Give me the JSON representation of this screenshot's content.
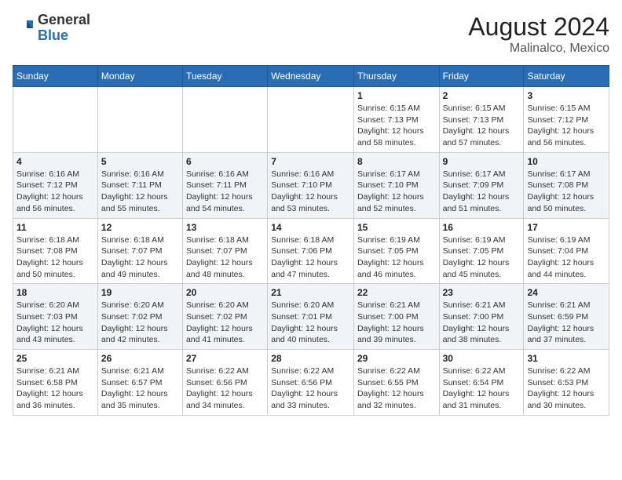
{
  "header": {
    "logo_general": "General",
    "logo_blue": "Blue",
    "month_year": "August 2024",
    "location": "Malinalco, Mexico"
  },
  "calendar": {
    "days_of_week": [
      "Sunday",
      "Monday",
      "Tuesday",
      "Wednesday",
      "Thursday",
      "Friday",
      "Saturday"
    ],
    "weeks": [
      [
        {
          "day": "",
          "info": ""
        },
        {
          "day": "",
          "info": ""
        },
        {
          "day": "",
          "info": ""
        },
        {
          "day": "",
          "info": ""
        },
        {
          "day": "1",
          "info": "Sunrise: 6:15 AM\nSunset: 7:13 PM\nDaylight: 12 hours\nand 58 minutes."
        },
        {
          "day": "2",
          "info": "Sunrise: 6:15 AM\nSunset: 7:13 PM\nDaylight: 12 hours\nand 57 minutes."
        },
        {
          "day": "3",
          "info": "Sunrise: 6:15 AM\nSunset: 7:12 PM\nDaylight: 12 hours\nand 56 minutes."
        }
      ],
      [
        {
          "day": "4",
          "info": "Sunrise: 6:16 AM\nSunset: 7:12 PM\nDaylight: 12 hours\nand 56 minutes."
        },
        {
          "day": "5",
          "info": "Sunrise: 6:16 AM\nSunset: 7:11 PM\nDaylight: 12 hours\nand 55 minutes."
        },
        {
          "day": "6",
          "info": "Sunrise: 6:16 AM\nSunset: 7:11 PM\nDaylight: 12 hours\nand 54 minutes."
        },
        {
          "day": "7",
          "info": "Sunrise: 6:16 AM\nSunset: 7:10 PM\nDaylight: 12 hours\nand 53 minutes."
        },
        {
          "day": "8",
          "info": "Sunrise: 6:17 AM\nSunset: 7:10 PM\nDaylight: 12 hours\nand 52 minutes."
        },
        {
          "day": "9",
          "info": "Sunrise: 6:17 AM\nSunset: 7:09 PM\nDaylight: 12 hours\nand 51 minutes."
        },
        {
          "day": "10",
          "info": "Sunrise: 6:17 AM\nSunset: 7:08 PM\nDaylight: 12 hours\nand 50 minutes."
        }
      ],
      [
        {
          "day": "11",
          "info": "Sunrise: 6:18 AM\nSunset: 7:08 PM\nDaylight: 12 hours\nand 50 minutes."
        },
        {
          "day": "12",
          "info": "Sunrise: 6:18 AM\nSunset: 7:07 PM\nDaylight: 12 hours\nand 49 minutes."
        },
        {
          "day": "13",
          "info": "Sunrise: 6:18 AM\nSunset: 7:07 PM\nDaylight: 12 hours\nand 48 minutes."
        },
        {
          "day": "14",
          "info": "Sunrise: 6:18 AM\nSunset: 7:06 PM\nDaylight: 12 hours\nand 47 minutes."
        },
        {
          "day": "15",
          "info": "Sunrise: 6:19 AM\nSunset: 7:05 PM\nDaylight: 12 hours\nand 46 minutes."
        },
        {
          "day": "16",
          "info": "Sunrise: 6:19 AM\nSunset: 7:05 PM\nDaylight: 12 hours\nand 45 minutes."
        },
        {
          "day": "17",
          "info": "Sunrise: 6:19 AM\nSunset: 7:04 PM\nDaylight: 12 hours\nand 44 minutes."
        }
      ],
      [
        {
          "day": "18",
          "info": "Sunrise: 6:20 AM\nSunset: 7:03 PM\nDaylight: 12 hours\nand 43 minutes."
        },
        {
          "day": "19",
          "info": "Sunrise: 6:20 AM\nSunset: 7:02 PM\nDaylight: 12 hours\nand 42 minutes."
        },
        {
          "day": "20",
          "info": "Sunrise: 6:20 AM\nSunset: 7:02 PM\nDaylight: 12 hours\nand 41 minutes."
        },
        {
          "day": "21",
          "info": "Sunrise: 6:20 AM\nSunset: 7:01 PM\nDaylight: 12 hours\nand 40 minutes."
        },
        {
          "day": "22",
          "info": "Sunrise: 6:21 AM\nSunset: 7:00 PM\nDaylight: 12 hours\nand 39 minutes."
        },
        {
          "day": "23",
          "info": "Sunrise: 6:21 AM\nSunset: 7:00 PM\nDaylight: 12 hours\nand 38 minutes."
        },
        {
          "day": "24",
          "info": "Sunrise: 6:21 AM\nSunset: 6:59 PM\nDaylight: 12 hours\nand 37 minutes."
        }
      ],
      [
        {
          "day": "25",
          "info": "Sunrise: 6:21 AM\nSunset: 6:58 PM\nDaylight: 12 hours\nand 36 minutes."
        },
        {
          "day": "26",
          "info": "Sunrise: 6:21 AM\nSunset: 6:57 PM\nDaylight: 12 hours\nand 35 minutes."
        },
        {
          "day": "27",
          "info": "Sunrise: 6:22 AM\nSunset: 6:56 PM\nDaylight: 12 hours\nand 34 minutes."
        },
        {
          "day": "28",
          "info": "Sunrise: 6:22 AM\nSunset: 6:56 PM\nDaylight: 12 hours\nand 33 minutes."
        },
        {
          "day": "29",
          "info": "Sunrise: 6:22 AM\nSunset: 6:55 PM\nDaylight: 12 hours\nand 32 minutes."
        },
        {
          "day": "30",
          "info": "Sunrise: 6:22 AM\nSunset: 6:54 PM\nDaylight: 12 hours\nand 31 minutes."
        },
        {
          "day": "31",
          "info": "Sunrise: 6:22 AM\nSunset: 6:53 PM\nDaylight: 12 hours\nand 30 minutes."
        }
      ]
    ]
  }
}
